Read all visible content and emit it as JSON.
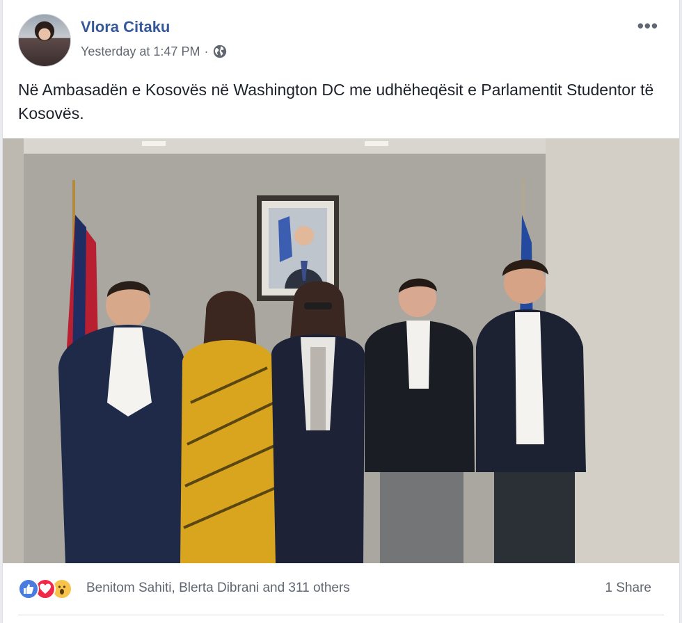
{
  "post": {
    "author": "Vlora Citaku",
    "timestamp": "Yesterday at 1:47 PM",
    "separator": "·",
    "privacy_icon": "globe-icon",
    "more_icon": "more-options-icon",
    "more_label": "•••",
    "text": "Në Ambasadën e Kosovës në Washington DC me udhëheqësit e Parlamentit Studentor të Kosovës."
  },
  "reactions": {
    "icons": [
      "like-icon",
      "love-icon",
      "wow-icon"
    ],
    "names": "Benitom Sahiti, Blerta Dibrani and 311 others",
    "shares": "1 Share"
  },
  "colors": {
    "author_link": "#365899",
    "meta_text": "#616770",
    "like": "#4a7be0",
    "love": "#f0284a",
    "wow": "#f7c34a"
  }
}
